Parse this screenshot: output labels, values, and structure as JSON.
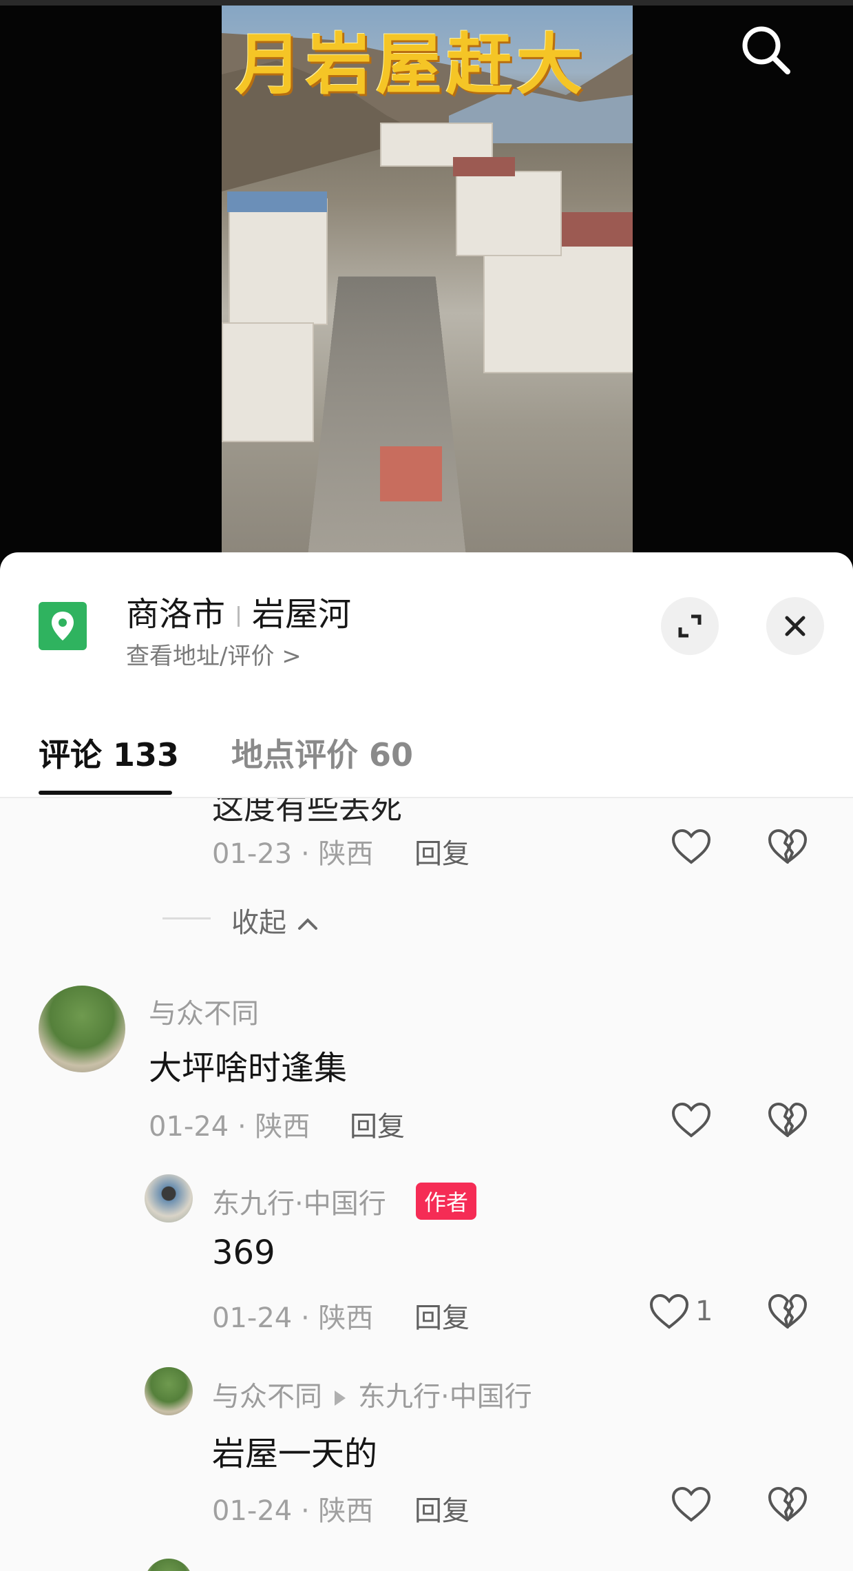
{
  "video": {
    "banner_text": "月岩屋赶大",
    "search_icon": "search-icon"
  },
  "location": {
    "icon": "location-pin-icon",
    "city": "商洛市",
    "place": "岩屋河",
    "subtitle": "查看地址/评价 >",
    "accent": "#2fb35f"
  },
  "tabs": [
    {
      "label": "评论 133",
      "active": true
    },
    {
      "label": "地点评价 60",
      "active": false
    }
  ],
  "comments": {
    "partial": {
      "text_clipped": "这度有些丢死",
      "date_region": "01-23 · 陕西",
      "reply_label": "回复"
    },
    "collapse_label": "收起",
    "items": [
      {
        "username": "与众不同",
        "text": "大坪啥时逢集",
        "date_region": "01-24 · 陕西",
        "reply_label": "回复"
      },
      {
        "username": "东九行·中国行",
        "badge": "作者",
        "text": "369",
        "date_region": "01-24 · 陕西",
        "reply_label": "回复",
        "likes": "1"
      },
      {
        "username": "与众不同",
        "reply_to": "东九行·中国行",
        "text": "岩屋一天的",
        "date_region": "01-24 · 陕西",
        "reply_label": "回复"
      }
    ]
  }
}
